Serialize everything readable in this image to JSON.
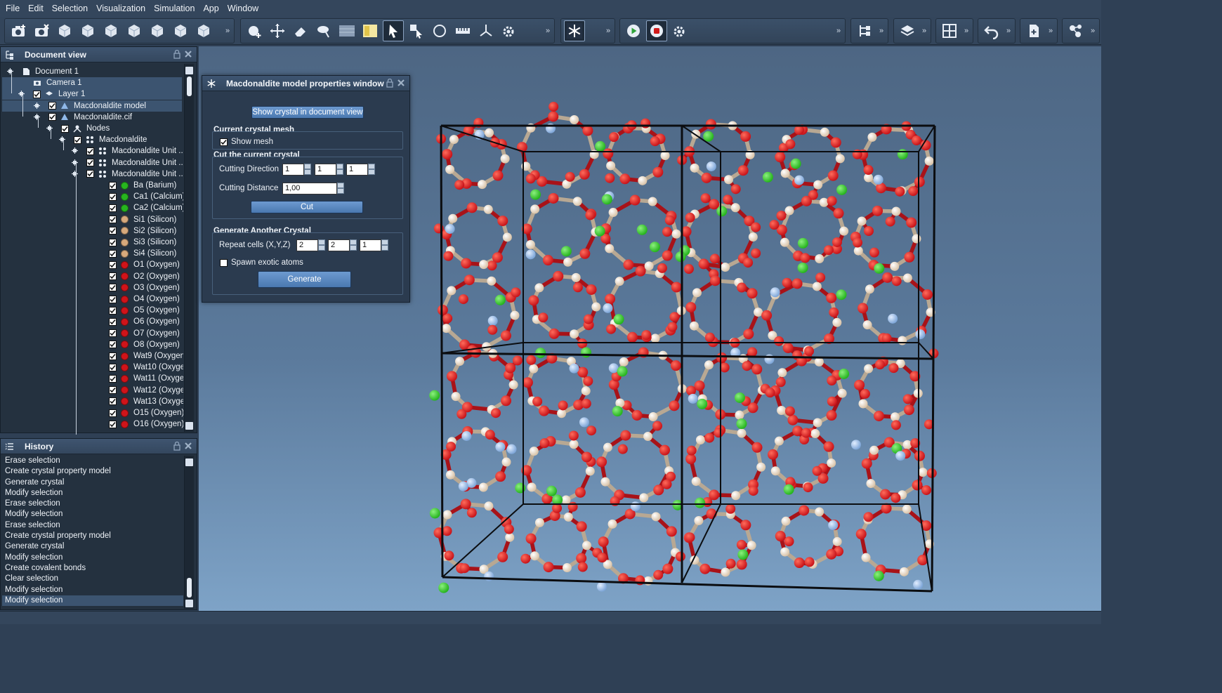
{
  "menu": [
    "File",
    "Edit",
    "Selection",
    "Visualization",
    "Simulation",
    "App",
    "Window"
  ],
  "toolbar": {
    "icons": [
      "camera-add-icon",
      "camera-remove-icon",
      "cube-view-icon",
      "cube-front-icon",
      "cube-back-icon",
      "cube-left-icon",
      "cube-right-icon",
      "cube-top-icon",
      "cube-bottom-icon",
      "add-object-icon",
      "move-icon",
      "eraser-icon",
      "paint-icon",
      "ruler-grid-icon",
      "palette-icon",
      "select-arrow-icon",
      "select-area-icon",
      "rotate-icon",
      "measure-icon",
      "axes-icon",
      "settings-icon",
      "crystal-snowflake-icon",
      "play-icon",
      "stop-icon",
      "simulation-settings-icon",
      "tree-view-icon",
      "layers-icon",
      "grid-view-icon",
      "undo-icon",
      "new-document-icon",
      "molecule-icon"
    ]
  },
  "document_view": {
    "title": "Document view",
    "items": [
      {
        "label": "Document 1",
        "type": "document"
      },
      {
        "label": "Camera 1",
        "type": "camera"
      },
      {
        "label": "Layer 1",
        "type": "layer"
      },
      {
        "label": "Macdonaldite model",
        "type": "model"
      },
      {
        "label": "Macdonaldite.cif",
        "type": "model"
      },
      {
        "label": "Nodes",
        "type": "nodes"
      },
      {
        "label": "Macdonaldite",
        "type": "group"
      },
      {
        "label": "Macdonaldite Unit ...",
        "type": "group"
      },
      {
        "label": "Macdonaldite Unit ...",
        "type": "group"
      },
      {
        "label": "Macdonaldite Unit ...",
        "type": "group"
      },
      {
        "label": "Ba (Barium)",
        "color": "#27b51f"
      },
      {
        "label": "Ca1 (Calcium)",
        "color": "#27b51f"
      },
      {
        "label": "Ca2 (Calcium)",
        "color": "#27b51f"
      },
      {
        "label": "Si1 (Silicon)",
        "color": "#d7a97c"
      },
      {
        "label": "Si2 (Silicon)",
        "color": "#d7a97c"
      },
      {
        "label": "Si3 (Silicon)",
        "color": "#d7a97c"
      },
      {
        "label": "Si4 (Silicon)",
        "color": "#d7a97c"
      },
      {
        "label": "O1 (Oxygen)",
        "color": "#d0141a"
      },
      {
        "label": "O2 (Oxygen)",
        "color": "#d0141a"
      },
      {
        "label": "O3 (Oxygen)",
        "color": "#d0141a"
      },
      {
        "label": "O4 (Oxygen)",
        "color": "#d0141a"
      },
      {
        "label": "O5 (Oxygen)",
        "color": "#d0141a"
      },
      {
        "label": "O6 (Oxygen)",
        "color": "#d0141a"
      },
      {
        "label": "O7 (Oxygen)",
        "color": "#d0141a"
      },
      {
        "label": "O8 (Oxygen)",
        "color": "#d0141a"
      },
      {
        "label": "Wat9 (Oxygen)",
        "color": "#d0141a"
      },
      {
        "label": "Wat10 (Oxygen)",
        "color": "#d0141a"
      },
      {
        "label": "Wat11 (Oxygen)",
        "color": "#d0141a"
      },
      {
        "label": "Wat12 (Oxygen)",
        "color": "#d0141a"
      },
      {
        "label": "Wat13 (Oxygen)",
        "color": "#d0141a"
      },
      {
        "label": "O15 (Oxygen)",
        "color": "#d0141a"
      },
      {
        "label": "O16 (Oxygen)",
        "color": "#d0141a"
      }
    ]
  },
  "history": {
    "title": "History",
    "items": [
      "Erase selection",
      "Create crystal property model",
      "Generate crystal",
      "Modify selection",
      "Erase selection",
      "Modify selection",
      "Erase selection",
      "Create crystal property model",
      "Generate crystal",
      "Modify selection",
      "Create covalent bonds",
      "Clear selection",
      "Modify selection",
      "Modify selection"
    ]
  },
  "props": {
    "title": "Macdonaldite model properties window",
    "show_crystal_button": "Show crystal in document view",
    "mesh_section": "Current crystal mesh",
    "show_mesh_label": "Show mesh",
    "show_mesh_checked": true,
    "cut_section": "Cut the current crystal",
    "cutting_direction_label": "Cutting Direction",
    "cutting_direction": [
      "1",
      "1",
      "1"
    ],
    "cutting_distance_label": "Cutting Distance",
    "cutting_distance": "1,00",
    "cut_button": "Cut",
    "generate_section": "Generate Another Crystal",
    "repeat_cells_label": "Repeat cells (X,Y,Z)",
    "repeat_cells": [
      "2",
      "2",
      "1"
    ],
    "spawn_exotic_label": "Spawn exotic atoms",
    "spawn_exotic_checked": false,
    "generate_button": "Generate"
  },
  "colors": {
    "oxygen": "#c8141a",
    "silicon": "#d9c3a8",
    "calcium": "#26b41e",
    "blue_atom": "#7ea6d8",
    "accent": "#5b8bc6"
  }
}
